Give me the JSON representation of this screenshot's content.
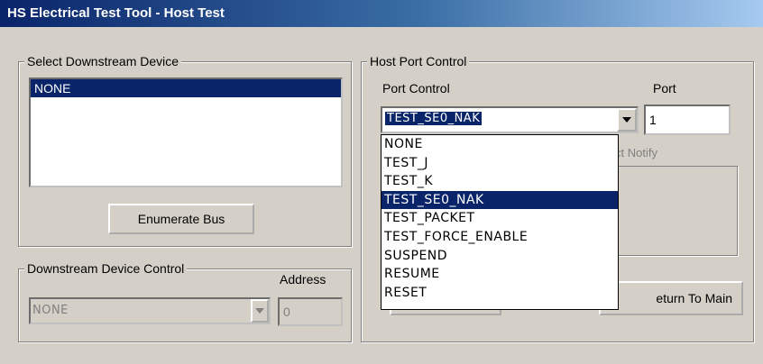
{
  "window": {
    "title": "HS Electrical Test Tool - Host Test"
  },
  "downstream_select": {
    "legend": "Select Downstream Device",
    "items": [
      "NONE"
    ],
    "enumerate_label": "Enumerate Bus"
  },
  "device_control": {
    "legend": "Downstream Device Control",
    "address_label": "Address",
    "device_value": "NONE",
    "address_value": "0"
  },
  "host_port": {
    "legend": "Host Port Control",
    "port_control_label": "Port Control",
    "port_label": "Port",
    "port_control_value": "TEST_SE0_NAK",
    "port_value": "1",
    "notify_partial": "ct Notify",
    "options": [
      "NONE",
      "TEST_J",
      "TEST_K",
      "TEST_SE0_NAK",
      "TEST_PACKET",
      "TEST_FORCE_ENABLE",
      "SUSPEND",
      "RESUME",
      "RESET"
    ],
    "selected_option": "TEST_SE0_NAK",
    "return_label": "eturn To Main"
  }
}
